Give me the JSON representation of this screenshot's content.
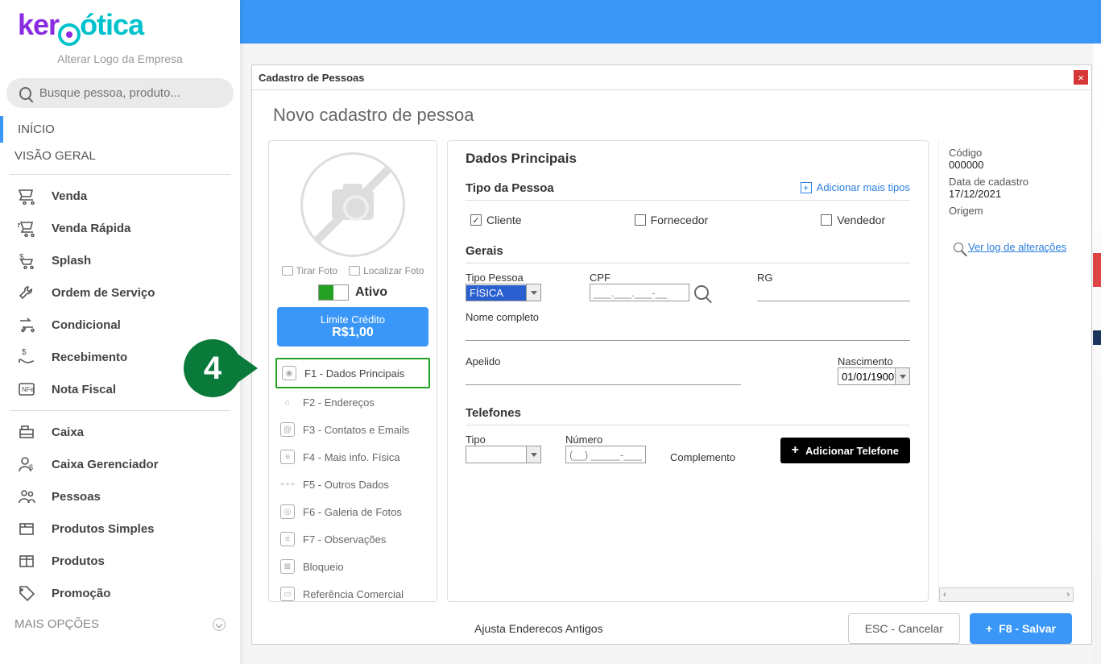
{
  "sidebar": {
    "alter_logo": "Alterar Logo da Empresa",
    "search_placeholder": "Busque pessoa, produto...",
    "inicio": "INÍCIO",
    "visao": "VISÃO GERAL",
    "items1": [
      {
        "label": "Venda"
      },
      {
        "label": "Venda Rápida"
      },
      {
        "label": "Splash"
      },
      {
        "label": "Ordem de Serviço"
      },
      {
        "label": "Condicional"
      },
      {
        "label": "Recebimento"
      },
      {
        "label": "Nota Fiscal"
      }
    ],
    "items2": [
      {
        "label": "Caixa"
      },
      {
        "label": "Caixa Gerenciador"
      },
      {
        "label": "Pessoas"
      },
      {
        "label": "Produtos Simples"
      },
      {
        "label": "Produtos"
      },
      {
        "label": "Promoção"
      }
    ],
    "mais": "MAIS OPÇÕES"
  },
  "dialog": {
    "title": "Cadastro de Pessoas",
    "subtitle": "Novo cadastro de pessoa",
    "photo": {
      "tirar": "Tirar Foto",
      "localizar": "Localizar Foto",
      "ativo": "Ativo"
    },
    "limite": {
      "label": "Limite Crédito",
      "valor": "R$1,00"
    },
    "tabs": [
      {
        "label": "F1 - Dados Principais"
      },
      {
        "label": "F2 - Endereços"
      },
      {
        "label": "F3 - Contatos e Emails"
      },
      {
        "label": "F4 - Mais info. Física"
      },
      {
        "label": "F5 - Outros Dados"
      },
      {
        "label": "F6 - Galeria de Fotos"
      },
      {
        "label": "F7 - Observações"
      },
      {
        "label": "Bloqueio"
      },
      {
        "label": "Referência Comercial"
      }
    ],
    "main": {
      "sec_title": "Dados Principais",
      "tipo_pessoa_title": "Tipo da Pessoa",
      "add_more": "Adicionar mais tipos",
      "chk_cliente": "Cliente",
      "chk_fornecedor": "Fornecedor",
      "chk_vendedor": "Vendedor",
      "gerais": "Gerais",
      "tipo_pessoa_label": "Tipo Pessoa",
      "tipo_pessoa_value": "FÍSICA",
      "cpf_label": "CPF",
      "cpf_mask": "___.___.___-__",
      "rg_label": "RG",
      "nome_label": "Nome completo",
      "apelido_label": "Apelido",
      "nasc_label": "Nascimento",
      "nasc_value": "01/01/1900",
      "tel_title": "Telefones",
      "tel_tipo": "Tipo",
      "tel_num": "Número",
      "tel_num_mask": "(__) _____-____",
      "tel_comp": "Complemento",
      "add_phone": "Adicionar Telefone"
    },
    "right": {
      "codigo_lbl": "Código",
      "codigo": "000000",
      "data_lbl": "Data de cadastro",
      "data": "17/12/2021",
      "origem_lbl": "Origem",
      "log": "Ver log de alterações"
    },
    "footer": {
      "ajusta": "Ajusta Enderecos Antigos",
      "cancel": "ESC - Cancelar",
      "save": "F8 - Salvar"
    }
  },
  "callout_number": "4"
}
